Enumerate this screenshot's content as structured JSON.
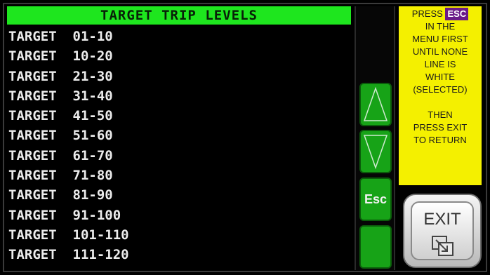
{
  "header": {
    "title": "TARGET  TRIP LEVELS"
  },
  "menu": {
    "items": [
      {
        "label": "TARGET  01-10"
      },
      {
        "label": "TARGET  10-20"
      },
      {
        "label": "TARGET  21-30"
      },
      {
        "label": "TARGET  31-40"
      },
      {
        "label": "TARGET  41-50"
      },
      {
        "label": "TARGET  51-60"
      },
      {
        "label": "TARGET  61-70"
      },
      {
        "label": "TARGET  71-80"
      },
      {
        "label": "TARGET  81-90"
      },
      {
        "label": "TARGET  91-100"
      },
      {
        "label": "TARGET  101-110"
      },
      {
        "label": "TARGET  111-120"
      }
    ]
  },
  "nav": {
    "up_icon": "up-arrow-icon",
    "down_icon": "down-arrow-icon",
    "esc_label": "Esc"
  },
  "help": {
    "press": "PRESS",
    "esc": "ESC",
    "lines": [
      "IN THE",
      "MENU FIRST",
      "UNTIL NONE",
      "LINE IS",
      "WHITE",
      "(SELECTED)",
      "",
      "THEN",
      "PRESS EXIT",
      "TO RETURN"
    ]
  },
  "exit": {
    "label": "EXIT",
    "icon": "exit-window-icon"
  },
  "colors": {
    "header_bg": "#1ee61e",
    "button_green": "#17a317",
    "help_bg": "#f4f000",
    "esc_tag_bg": "#6a1a88"
  }
}
